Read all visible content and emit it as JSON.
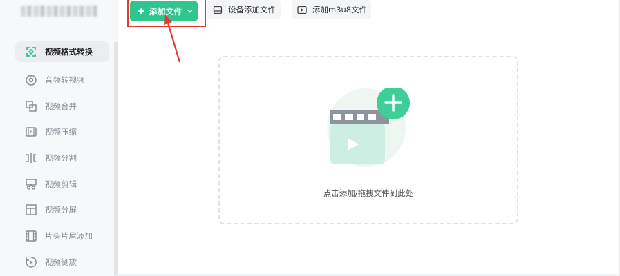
{
  "sidebar": {
    "items": [
      {
        "label": "视频格式转换",
        "icon": "convert-icon",
        "active": true
      },
      {
        "label": "音频转视频",
        "icon": "disc-icon"
      },
      {
        "label": "视频合并",
        "icon": "merge-icon"
      },
      {
        "label": "视频压缩",
        "icon": "compress-icon"
      },
      {
        "label": "视频分割",
        "icon": "split-icon"
      },
      {
        "label": "视频剪辑",
        "icon": "scissors-icon"
      },
      {
        "label": "视频分屏",
        "icon": "split-screen-icon"
      },
      {
        "label": "片头片尾添加",
        "icon": "film-icon"
      },
      {
        "label": "视频倒放",
        "icon": "reverse-play-icon"
      }
    ]
  },
  "toolbar": {
    "add_file_label": "添加文件",
    "device_add_label": "设备添加文件",
    "m3u8_add_label": "添加m3u8文件"
  },
  "dropzone": {
    "hint": "点击添加/拖拽文件到此处"
  },
  "colors": {
    "accent": "#2fc58d",
    "highlight": "#e03b2f"
  }
}
